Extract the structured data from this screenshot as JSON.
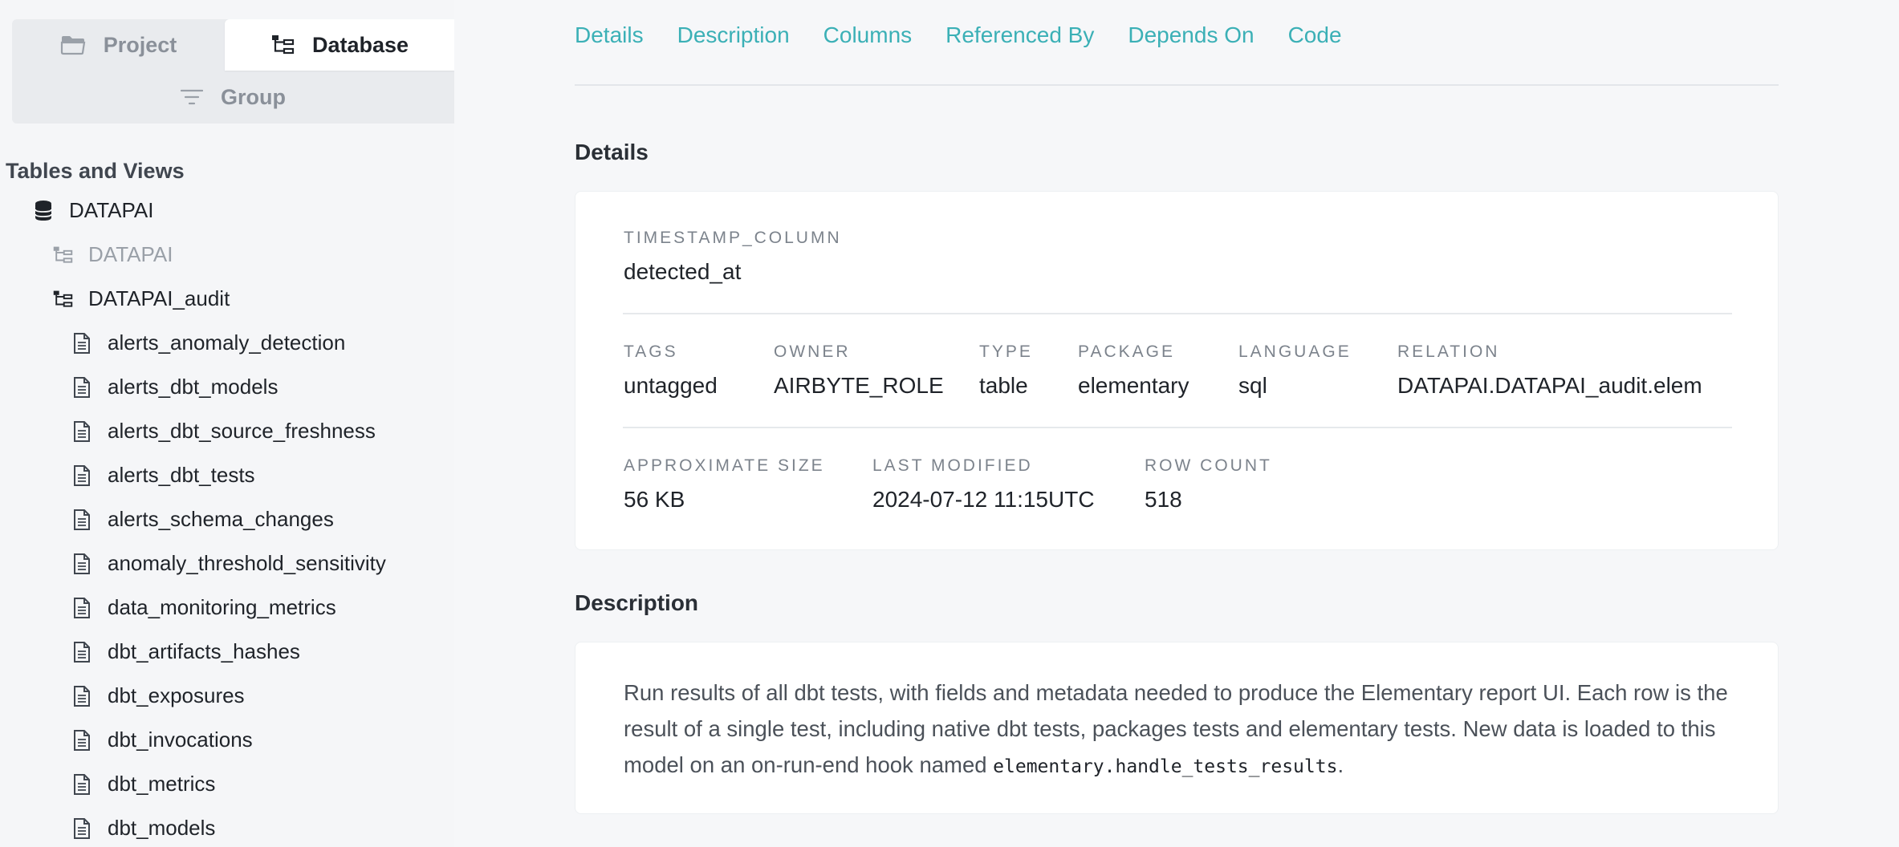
{
  "switcher": {
    "project_label": "Project",
    "database_label": "Database",
    "group_label": "Group"
  },
  "tree": {
    "title": "Tables and Views",
    "database": "DATAPAI",
    "schemas": [
      "DATAPAI",
      "DATAPAI_audit"
    ],
    "tables": [
      "alerts_anomaly_detection",
      "alerts_dbt_models",
      "alerts_dbt_source_freshness",
      "alerts_dbt_tests",
      "alerts_schema_changes",
      "anomaly_threshold_sensitivity",
      "data_monitoring_metrics",
      "dbt_artifacts_hashes",
      "dbt_exposures",
      "dbt_invocations",
      "dbt_metrics",
      "dbt_models"
    ]
  },
  "tabs": [
    "Details",
    "Description",
    "Columns",
    "Referenced By",
    "Depends On",
    "Code"
  ],
  "details": {
    "heading": "Details",
    "timestamp_column": {
      "label": "TIMESTAMP_COLUMN",
      "value": "detected_at"
    },
    "row1": [
      {
        "label": "TAGS",
        "value": "untagged"
      },
      {
        "label": "OWNER",
        "value": "AIRBYTE_ROLE"
      },
      {
        "label": "TYPE",
        "value": "table"
      },
      {
        "label": "PACKAGE",
        "value": "elementary"
      },
      {
        "label": "LANGUAGE",
        "value": "sql"
      },
      {
        "label": "RELATION",
        "value": "DATAPAI.DATAPAI_audit.elem"
      }
    ],
    "row2": [
      {
        "label": "APPROXIMATE SIZE",
        "value": "56 KB"
      },
      {
        "label": "LAST MODIFIED",
        "value": "2024-07-12 11:15UTC"
      },
      {
        "label": "ROW COUNT",
        "value": "518"
      }
    ]
  },
  "description": {
    "heading": "Description",
    "text": "Run results of all dbt tests, with fields and metadata needed to produce the Elementary report UI. Each row is the result of a single test, including native dbt tests, packages tests and elementary tests. New data is loaded to this model on an on-run-end hook named ",
    "code": "elementary.handle_tests_results",
    "suffix": "."
  },
  "colors": {
    "accent": "#3bb0b6",
    "background": "#f6f7f9",
    "card": "#ffffff"
  }
}
